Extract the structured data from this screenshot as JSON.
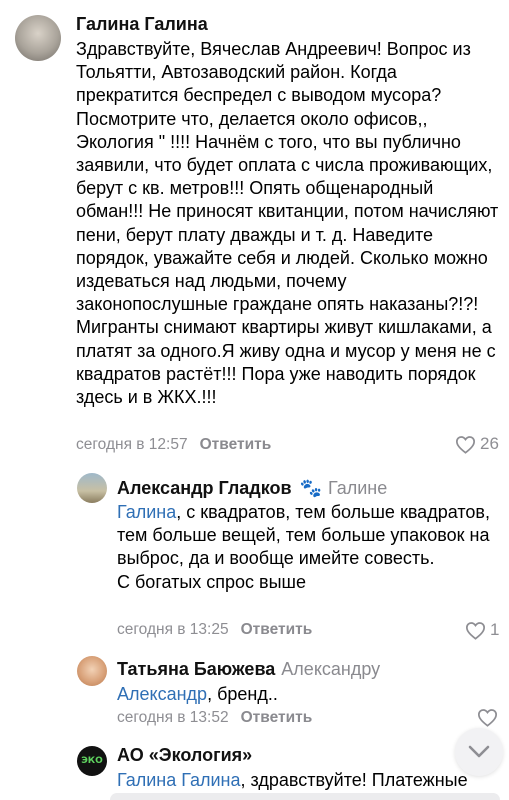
{
  "comments": [
    {
      "author": "Галина Галина",
      "reply_to": "",
      "mention": "",
      "text": "Здравствуйте, Вячеслав Андреевич! Вопрос из Тольятти, Автозаводский район. Когда прекратится беспредел с выводом мусора? Посмотрите что, делается около офисов,, Экология \" !!!!  Начнём с того, что вы публично заявили, что будет оплата с числа проживающих, берут с кв. метров!!! Опять общенародный обман!!! Не приносят квитанции, потом начисляют пени, берут плату дважды и т. д. Наведите порядок, уважайте себя и людей. Сколько можно издеваться над людьми, почему законопослушные граждане опять наказаны?!?! Мигранты снимают квартиры живут кишлаками, а платят за одного.Я живу одна и мусор у меня не с квадратов растёт!!! Пора уже наводить порядок здесь и в ЖКХ.!!!",
      "time": "сегодня в 12:57",
      "reply_label": "Ответить",
      "likes": "26"
    },
    {
      "author": "Александр Гладков",
      "reply_to": "Галине",
      "mention": "Галина",
      "text": ", с квадратов, тем больше квадратов, тем больше вещей, тем больше упаковок на выброс, да и вообще имейте совесть.\nС богатых спрос выше",
      "time": "сегодня в 13:25",
      "reply_label": "Ответить",
      "likes": "1"
    },
    {
      "author": "Татьяна Баюжева",
      "reply_to": "Александру",
      "mention": "Александр",
      "text": ", бренд..",
      "time": "сегодня в 13:52",
      "reply_label": "Ответить",
      "likes": ""
    },
    {
      "author": "АО «Экология»",
      "reply_to": "",
      "mention": "Галина Галина",
      "text": ", здравствуйте! Платежные",
      "avatar_text": "ЭКО"
    }
  ],
  "icons": {
    "like": "heart-outline-icon",
    "scroll": "chevron-down-icon",
    "badge": "paw-icon"
  },
  "colors": {
    "link": "#2f6fb5",
    "meta": "#8e8e93"
  }
}
